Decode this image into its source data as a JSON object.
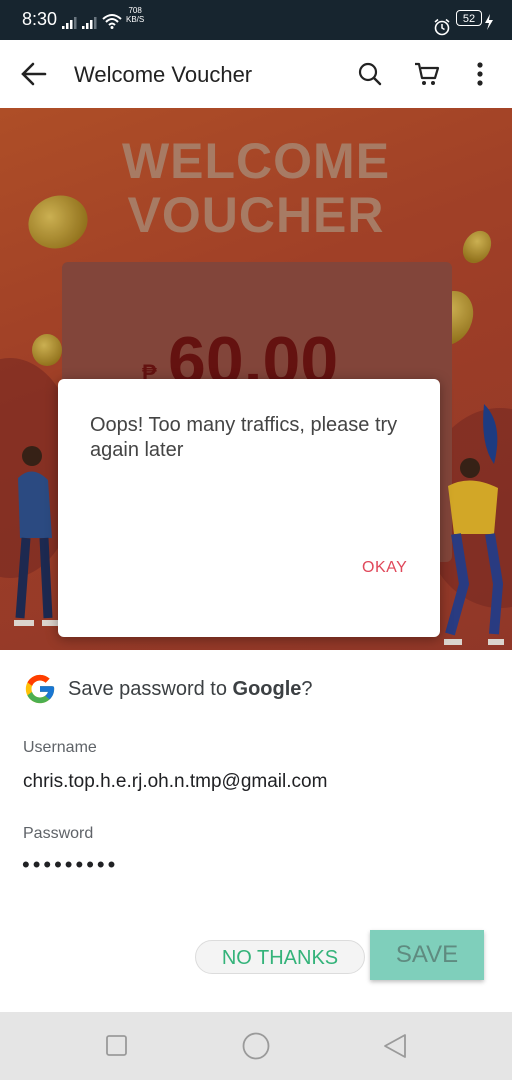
{
  "status_bar": {
    "time": "8:30",
    "net_speed_value": "708",
    "net_speed_unit": "KB/S",
    "battery": "52"
  },
  "app_bar": {
    "title": "Welcome Voucher",
    "icons": [
      "back-arrow-icon",
      "search-icon",
      "cart-icon",
      "more-vert-icon"
    ]
  },
  "banner": {
    "title_line1": "WELCOME",
    "title_line2": "VOUCHER",
    "currency": "₱",
    "amount": "60.00"
  },
  "dialog": {
    "message": "Oops! Too many traffics, please try again later",
    "okay_label": "OKAY"
  },
  "save_password": {
    "title_prefix": "Save password to ",
    "title_brand": "Google",
    "title_suffix": "?",
    "username_label": "Username",
    "username_value": "chris.top.h.e.rj.oh.n.tmp@gmail.com",
    "password_label": "Password",
    "password_value": "•••••••••",
    "no_thanks_label": "NO THANKS",
    "save_label": "SAVE"
  },
  "colors": {
    "accent_green": "#34b37a",
    "save_button": "#7fcfbb",
    "okay_red": "#e0485a",
    "status_bar": "#17252f"
  }
}
